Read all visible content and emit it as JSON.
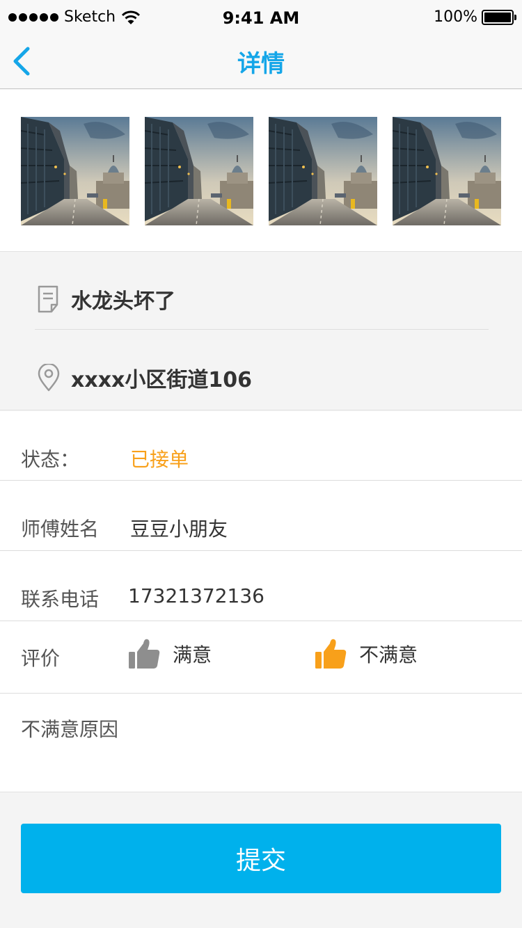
{
  "statusbar": {
    "carrier": "Sketch",
    "time": "9:41 AM",
    "battery": "100%"
  },
  "nav": {
    "title": "详情"
  },
  "photos": [
    {
      "name": "photo-1"
    },
    {
      "name": "photo-2"
    },
    {
      "name": "photo-3"
    },
    {
      "name": "photo-4"
    }
  ],
  "order": {
    "description": "水龙头坏了",
    "address": "xxxx小区街道106"
  },
  "form": {
    "status_label": "状态：",
    "status_value": "已接单",
    "worker_label": "师傅姓名",
    "worker_value": "豆豆小朋友",
    "phone_label": "联系电话",
    "phone_value": "17321372136",
    "rating_label": "评价",
    "satisfied_label": "满意",
    "unsatisfied_label": "不满意",
    "reason_label": "不满意原因"
  },
  "submit_label": "提交",
  "colors": {
    "accent": "#15a6e8",
    "button": "#00b1ec",
    "orange": "#f8a01a",
    "gray_icon": "#8e8e8e"
  },
  "icons": {
    "back": "chevron-left-icon",
    "document": "document-icon",
    "location": "location-pin-icon",
    "thumbs_up": "thumbs-up-icon"
  }
}
